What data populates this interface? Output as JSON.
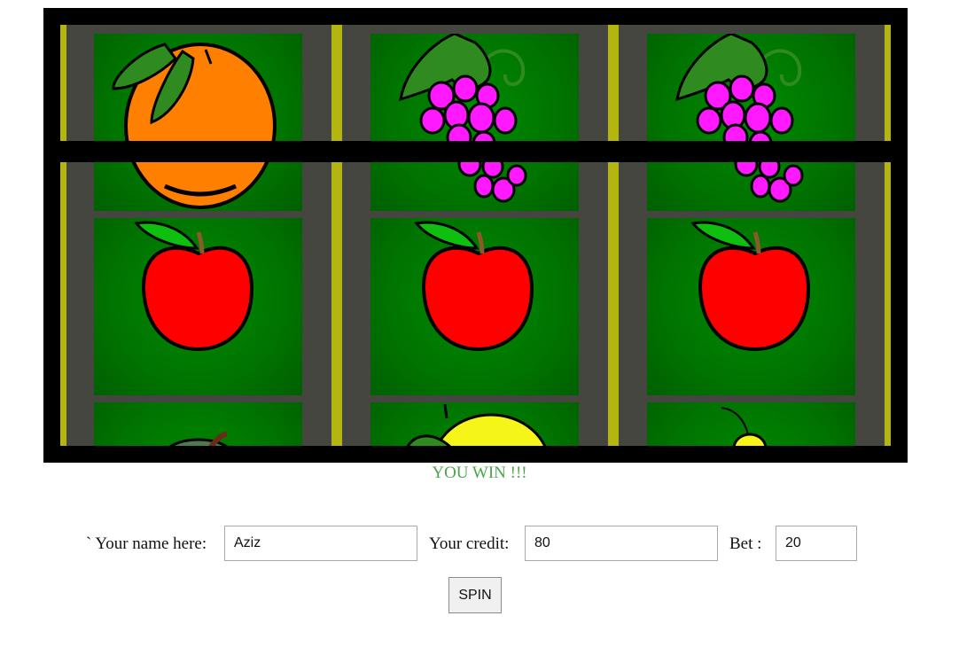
{
  "game": {
    "reels": [
      {
        "symbols": [
          "orange",
          "apple",
          "plum"
        ]
      },
      {
        "symbols": [
          "grapes",
          "apple",
          "lemon"
        ]
      },
      {
        "symbols": [
          "grapes",
          "apple",
          "pear"
        ]
      }
    ]
  },
  "status": {
    "message": "YOU WIN !!!",
    "color": "#4aa64a"
  },
  "form": {
    "name_label": "` Your name here:",
    "name_value": "Aziz",
    "credit_label": "Your credit:",
    "credit_value": "80",
    "bet_label": "Bet :",
    "bet_value": "20",
    "spin_label": "SPIN"
  },
  "colors": {
    "frame": "#000000",
    "reel_bg": "#464640",
    "separator": "#b5b512",
    "cell_green": "#007a00"
  }
}
